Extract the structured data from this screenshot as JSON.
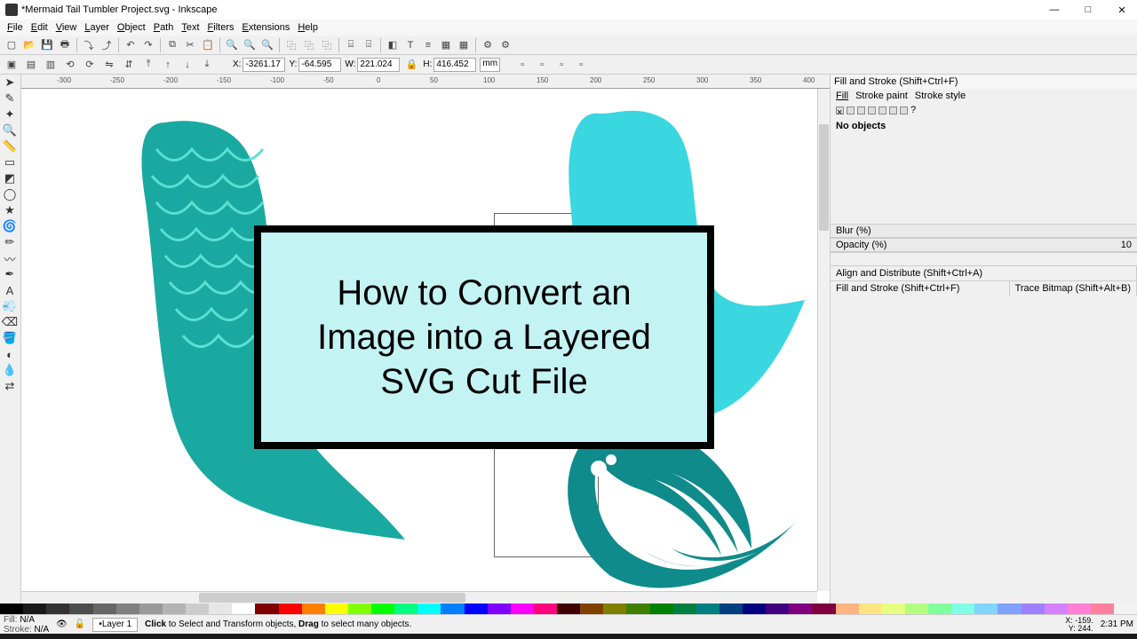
{
  "window": {
    "title": "*Mermaid Tail Tumbler Project.svg - Inkscape",
    "min": "—",
    "max": "□",
    "close": "✕"
  },
  "menus": [
    "File",
    "Edit",
    "View",
    "Layer",
    "Object",
    "Path",
    "Text",
    "Filters",
    "Extensions",
    "Help"
  ],
  "tool_context": {
    "x_label": "X:",
    "x_val": "-3261.17",
    "y_label": "Y:",
    "y_val": "-64.595",
    "w_label": "W:",
    "w_val": "221.024",
    "h_label": "H:",
    "h_val": "416.452",
    "unit": "mm"
  },
  "overlay_text": "How to Convert an Image into a Layered SVG Cut File",
  "fillstroke": {
    "title": "Fill and Stroke (Shift+Ctrl+F)",
    "tab_fill": "Fill",
    "tab_strokepaint": "Stroke paint",
    "tab_strokestyle": "Stroke style",
    "noobj": "No objects",
    "blur": "Blur (%)",
    "opacity": "Opacity (%)",
    "opacity_val": "10"
  },
  "docks": {
    "align": "Align and Distribute (Shift+Ctrl+A)",
    "fill": "Fill and Stroke (Shift+Ctrl+F)",
    "trace": "Trace Bitmap (Shift+Alt+B)"
  },
  "status": {
    "fill_label": "Fill:",
    "fill_val": "N/A",
    "stroke_label": "Stroke:",
    "stroke_val": "N/A",
    "layer": "Layer 1",
    "hint_pre": "Click",
    "hint_mid": " to Select and Transform objects, ",
    "hint_drag": "Drag",
    "hint_post": " to select many objects.",
    "x_label": "X:",
    "x_val": "-159.",
    "y_label": "Y:",
    "y_val": "244.",
    "time": "2:31 PM"
  },
  "ruler_ticks": [
    "-300",
    "-250",
    "-200",
    "-150",
    "-100",
    "-50",
    "0",
    "50",
    "100",
    "150",
    "200",
    "250",
    "300",
    "350",
    "400"
  ]
}
